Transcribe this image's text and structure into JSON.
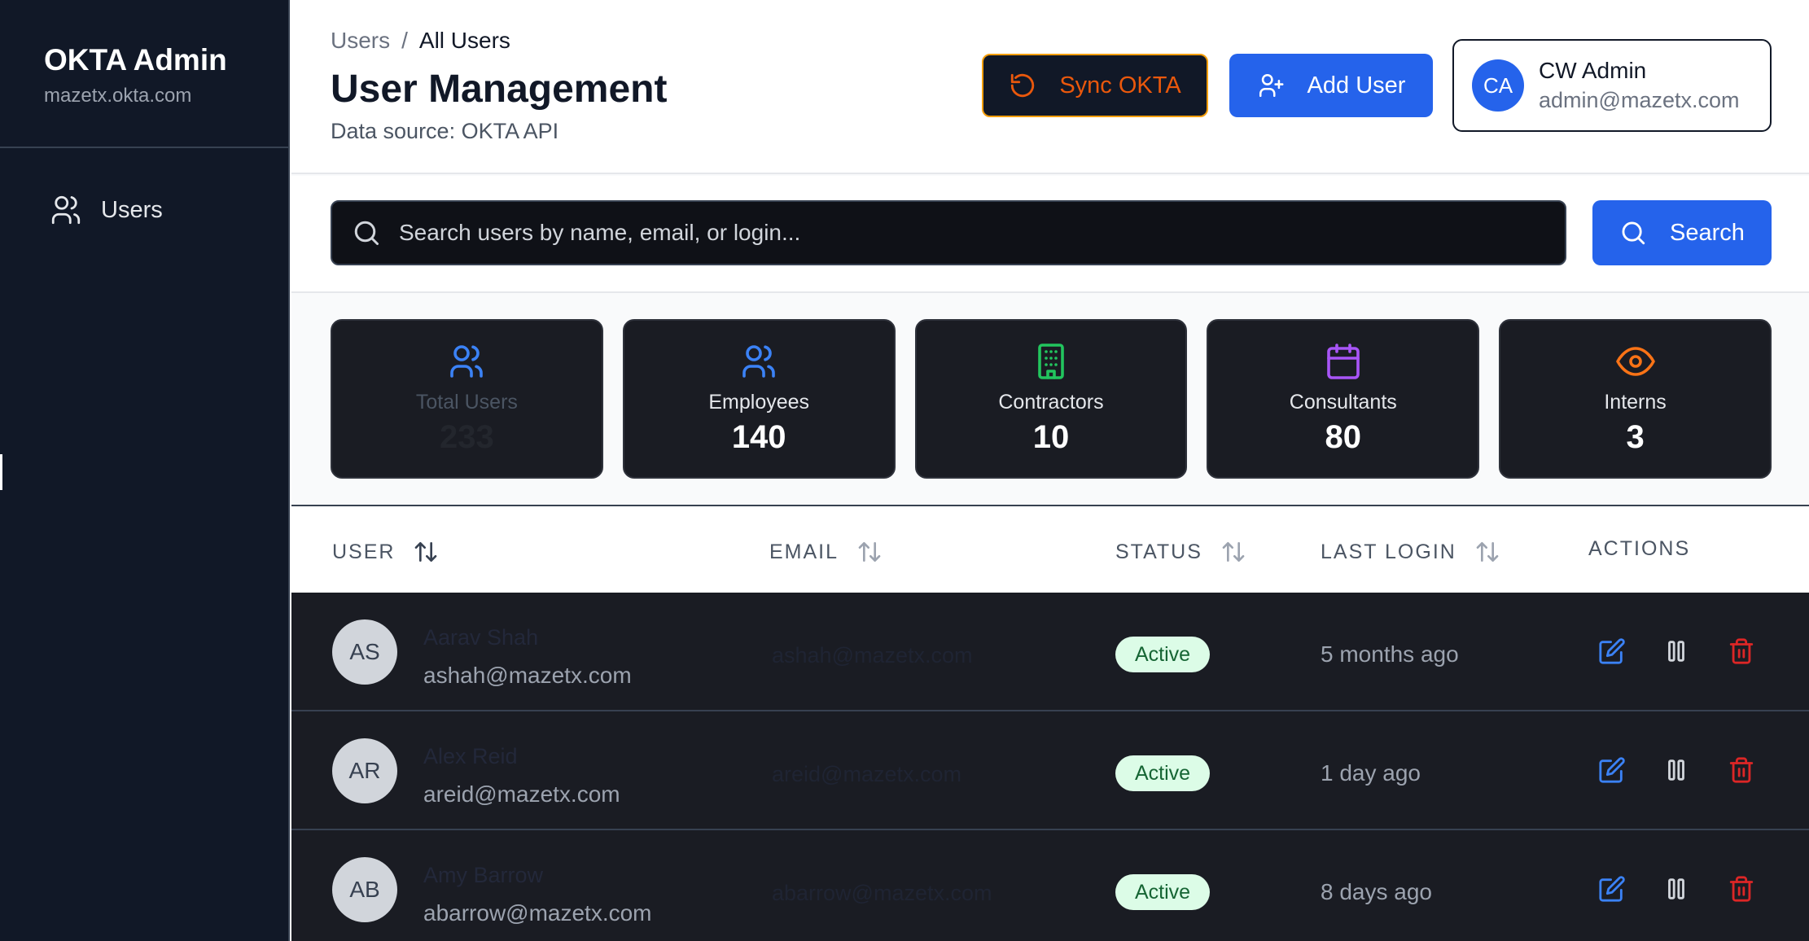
{
  "sidebar": {
    "title": "OKTA Admin",
    "domain": "mazetx.okta.com",
    "items": [
      {
        "label": "Users",
        "icon": "users-icon"
      }
    ]
  },
  "header": {
    "breadcrumb": {
      "parent": "Users",
      "separator": "/",
      "current": "All Users"
    },
    "title": "User Management",
    "subtitle": "Data source: OKTA API",
    "sync_label": "Sync OKTA",
    "add_label": "Add User",
    "profile": {
      "initials": "CA",
      "name": "CW Admin",
      "email": "admin@mazetx.com"
    }
  },
  "search": {
    "placeholder": "Search users by name, email, or login...",
    "value": "",
    "button_label": "Search"
  },
  "stats": [
    {
      "label": "Total Users",
      "value": "233",
      "icon": "users-icon",
      "color": "#3b82f6"
    },
    {
      "label": "Employees",
      "value": "140",
      "icon": "users-icon",
      "color": "#3b82f6"
    },
    {
      "label": "Contractors",
      "value": "10",
      "icon": "building-icon",
      "color": "#22c55e"
    },
    {
      "label": "Consultants",
      "value": "80",
      "icon": "calendar-icon",
      "color": "#a855f7"
    },
    {
      "label": "Interns",
      "value": "3",
      "icon": "eye-icon",
      "color": "#f97316"
    }
  ],
  "table": {
    "columns": [
      "USER",
      "EMAIL",
      "STATUS",
      "LAST LOGIN",
      "ACTIONS"
    ],
    "rows": [
      {
        "initials": "AS",
        "name": "Aarav Shah",
        "email": "ashah@mazetx.com",
        "status": "Active",
        "last_login": "5 months ago"
      },
      {
        "initials": "AR",
        "name": "Alex Reid",
        "email": "areid@mazetx.com",
        "status": "Active",
        "last_login": "1 day ago"
      },
      {
        "initials": "AB",
        "name": "Amy Barrow",
        "email": "abarrow@mazetx.com",
        "status": "Active",
        "last_login": "8 days ago"
      }
    ]
  },
  "colors": {
    "accent": "#2563eb",
    "sidebar_bg": "#111827",
    "sync_text": "#ea580c",
    "active_badge_bg": "#dcfce7",
    "delete": "#dc2626"
  }
}
